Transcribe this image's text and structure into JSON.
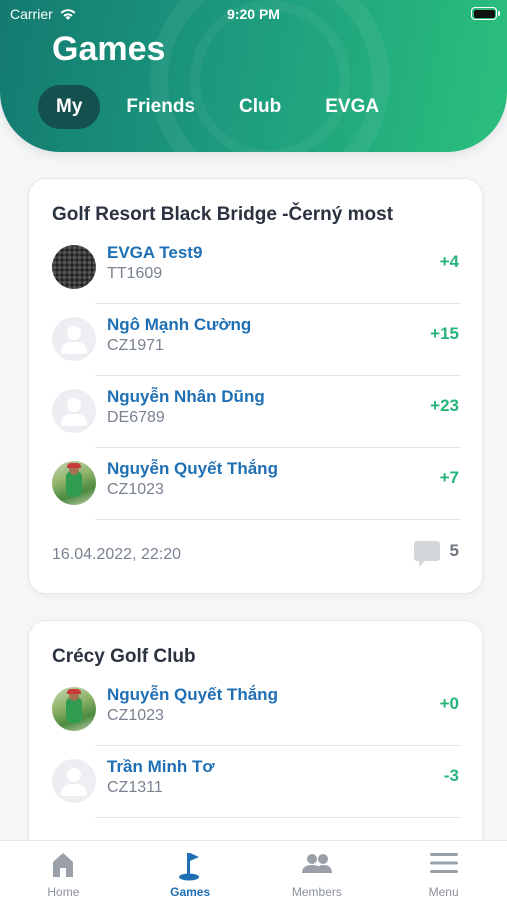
{
  "status_bar": {
    "carrier": "Carrier",
    "time": "9:20 PM"
  },
  "header": {
    "title": "Games",
    "tabs": [
      {
        "label": "My",
        "active": true
      },
      {
        "label": "Friends",
        "active": false
      },
      {
        "label": "Club",
        "active": false
      },
      {
        "label": "EVGA",
        "active": false
      }
    ]
  },
  "games": [
    {
      "course": "Golf Resort Black Bridge -Černý most",
      "players": [
        {
          "name": "EVGA Test9",
          "code": "TT1609",
          "score": "+4",
          "avatar": "golf-ball"
        },
        {
          "name": "Ngô Mạnh Cường",
          "code": "CZ1971",
          "score": "+15",
          "avatar": "default"
        },
        {
          "name": "Nguyễn Nhân Dũng",
          "code": "DE6789",
          "score": "+23",
          "avatar": "default"
        },
        {
          "name": "Nguyễn Quyết Thắng",
          "code": "CZ1023",
          "score": "+7",
          "avatar": "photo"
        }
      ],
      "date": "16.04.2022, 22:20",
      "comments": "5"
    },
    {
      "course": "Crécy Golf Club",
      "players": [
        {
          "name": "Nguyễn Quyết Thắng",
          "code": "CZ1023",
          "score": "+0",
          "avatar": "photo"
        },
        {
          "name": "Trần Minh Tơ",
          "code": "CZ1311",
          "score": "-3",
          "avatar": "default"
        }
      ]
    }
  ],
  "bottom_nav": [
    {
      "label": "Home",
      "icon": "home-icon",
      "active": false
    },
    {
      "label": "Games",
      "icon": "golf-flag-icon",
      "active": true
    },
    {
      "label": "Members",
      "icon": "members-icon",
      "active": false
    },
    {
      "label": "Menu",
      "icon": "menu-icon",
      "active": false
    }
  ],
  "colors": {
    "accent": "#1f6fb5",
    "score": "#27b47a",
    "header_start": "#137a70",
    "header_end": "#2bc07d"
  }
}
